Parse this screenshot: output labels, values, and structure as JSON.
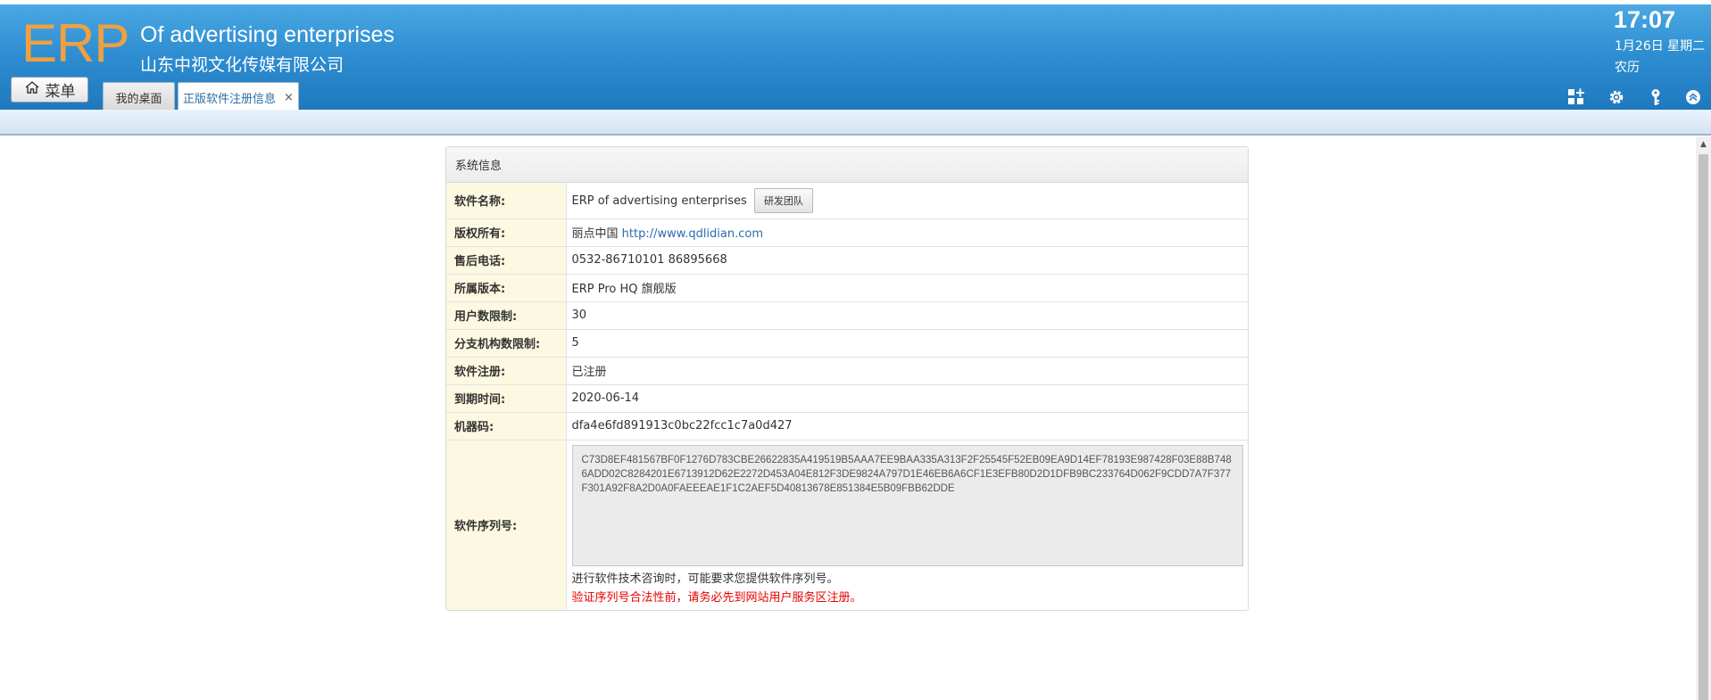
{
  "header": {
    "logo": "ERP",
    "company_en": "Of advertising enterprises",
    "company_cn": "山东中视文化传媒有限公司",
    "menu_label": "菜单",
    "time": "17:07",
    "date": "1月26日 星期二",
    "lunar": "农历",
    "icons": [
      "apps-add-icon",
      "gear-icon",
      "key-icon",
      "collapse-icon"
    ]
  },
  "tabs": [
    {
      "label": "我的桌面",
      "active": false
    },
    {
      "label": "正版软件注册信息",
      "active": true,
      "close": "×"
    }
  ],
  "panel": {
    "title": "系统信息",
    "rows": {
      "software_name": {
        "label": "软件名称:",
        "value": "ERP of advertising enterprises",
        "button": "研发团队"
      },
      "copyright": {
        "label": "版权所有:",
        "value": "丽点中国",
        "link": "http://www.qdlidian.com"
      },
      "phone": {
        "label": "售后电话:",
        "value": "0532-86710101 86895668"
      },
      "version": {
        "label": "所属版本:",
        "value": "ERP Pro HQ 旗舰版"
      },
      "user_limit": {
        "label": "用户数限制:",
        "value": "30"
      },
      "branch_limit": {
        "label": "分支机构数限制:",
        "value": "5"
      },
      "registration": {
        "label": "软件注册:",
        "value": "已注册"
      },
      "expiry": {
        "label": "到期时间:",
        "value": "2020-06-14"
      },
      "machine_code": {
        "label": "机器码:",
        "value": "dfa4e6fd891913c0bc22fcc1c7a0d427"
      },
      "serial": {
        "label": "软件序列号:",
        "value": "C73D8EF481567BF0F1276D783CBE26622835A419519B5AAA7EE9BAA335A313F2F25545F52EB09EA9D14EF78193E987428F03E88B7486ADD02C8284201E6713912D62E2272D453A04E812F3DE9824A797D1E46EB6A6CF1E3EFB80D2D1DFB9BC233764D062F9CDD7A7F377F301A92F8A2D0A0FAEEEAE1F1C2AEF5D40813678E851384E5B09FBB62DDE",
        "hint": "进行软件技术咨询时，可能要求您提供软件序列号。",
        "warning": "验证序列号合法性前，请务必先到网站用户服务区注册。"
      }
    }
  },
  "colors": {
    "header_top": "#4ba8e3",
    "header_bottom": "#1f78bd",
    "logo": "#f0a040",
    "label_bg": "#fcf8e1",
    "warning": "#e60000",
    "link": "#2a6cb0"
  }
}
